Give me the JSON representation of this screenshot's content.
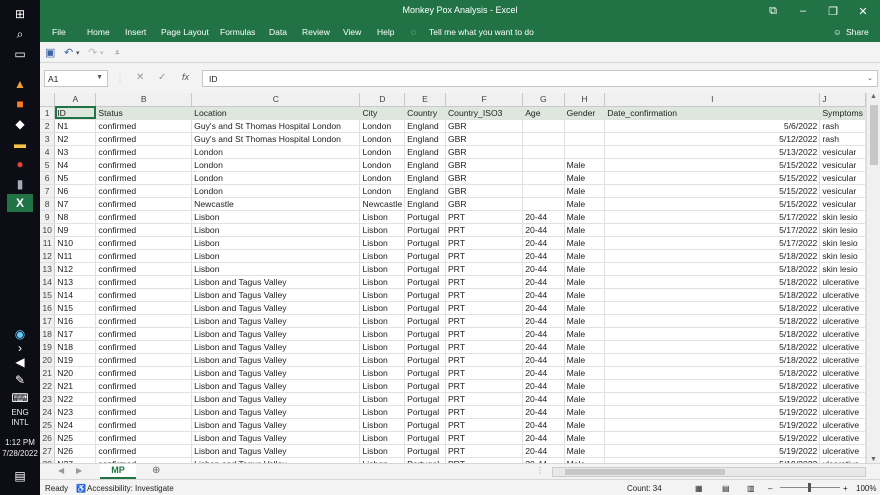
{
  "window": {
    "title": "Monkey Pox Analysis  -  Excel"
  },
  "ribbon": {
    "tabs": [
      "File",
      "Home",
      "Insert",
      "Page Layout",
      "Formulas",
      "Data",
      "Review",
      "View",
      "Help"
    ],
    "tell_me": "Tell me what you want to do",
    "share": "Share"
  },
  "formula_bar": {
    "name_box": "A1",
    "content": "ID",
    "fx": "fx"
  },
  "columns": [
    "A",
    "B",
    "C",
    "D",
    "E",
    "F",
    "G",
    "H",
    "I",
    "J"
  ],
  "headers": [
    "ID",
    "Status",
    "Location",
    "City",
    "Country",
    "Country_ISO3",
    "Age",
    "Gender",
    "Date_confirmation",
    "Symptoms"
  ],
  "rows": [
    [
      "2",
      "N1",
      "confirmed",
      "Guy's and St Thomas Hospital London",
      "London",
      "England",
      "GBR",
      "",
      "",
      "5/6/2022",
      "rash"
    ],
    [
      "3",
      "N2",
      "confirmed",
      "Guy's and St Thomas Hospital London",
      "London",
      "England",
      "GBR",
      "",
      "",
      "5/12/2022",
      "rash"
    ],
    [
      "4",
      "N3",
      "confirmed",
      "London",
      "London",
      "England",
      "GBR",
      "",
      "",
      "5/13/2022",
      "vesicular"
    ],
    [
      "5",
      "N4",
      "confirmed",
      "London",
      "London",
      "England",
      "GBR",
      "",
      "Male",
      "5/15/2022",
      "vesicular"
    ],
    [
      "6",
      "N5",
      "confirmed",
      "London",
      "London",
      "England",
      "GBR",
      "",
      "Male",
      "5/15/2022",
      "vesicular"
    ],
    [
      "7",
      "N6",
      "confirmed",
      "London",
      "London",
      "England",
      "GBR",
      "",
      "Male",
      "5/15/2022",
      "vesicular"
    ],
    [
      "8",
      "N7",
      "confirmed",
      "Newcastle",
      "Newcastle",
      "England",
      "GBR",
      "",
      "Male",
      "5/15/2022",
      "vesicular"
    ],
    [
      "9",
      "N8",
      "confirmed",
      "Lisbon",
      "Lisbon",
      "Portugal",
      "PRT",
      "20-44",
      "Male",
      "5/17/2022",
      "skin lesio"
    ],
    [
      "10",
      "N9",
      "confirmed",
      "Lisbon",
      "Lisbon",
      "Portugal",
      "PRT",
      "20-44",
      "Male",
      "5/17/2022",
      "skin lesio"
    ],
    [
      "11",
      "N10",
      "confirmed",
      "Lisbon",
      "Lisbon",
      "Portugal",
      "PRT",
      "20-44",
      "Male",
      "5/17/2022",
      "skin lesio"
    ],
    [
      "12",
      "N11",
      "confirmed",
      "Lisbon",
      "Lisbon",
      "Portugal",
      "PRT",
      "20-44",
      "Male",
      "5/18/2022",
      "skin lesio"
    ],
    [
      "13",
      "N12",
      "confirmed",
      "Lisbon",
      "Lisbon",
      "Portugal",
      "PRT",
      "20-44",
      "Male",
      "5/18/2022",
      "skin lesio"
    ],
    [
      "14",
      "N13",
      "confirmed",
      "Lisbon and Tagus Valley",
      "Lisbon",
      "Portugal",
      "PRT",
      "20-44",
      "Male",
      "5/18/2022",
      "ulcerative"
    ],
    [
      "15",
      "N14",
      "confirmed",
      "Lisbon and Tagus Valley",
      "Lisbon",
      "Portugal",
      "PRT",
      "20-44",
      "Male",
      "5/18/2022",
      "ulcerative"
    ],
    [
      "16",
      "N15",
      "confirmed",
      "Lisbon and Tagus Valley",
      "Lisbon",
      "Portugal",
      "PRT",
      "20-44",
      "Male",
      "5/18/2022",
      "ulcerative"
    ],
    [
      "17",
      "N16",
      "confirmed",
      "Lisbon and Tagus Valley",
      "Lisbon",
      "Portugal",
      "PRT",
      "20-44",
      "Male",
      "5/18/2022",
      "ulcerative"
    ],
    [
      "18",
      "N17",
      "confirmed",
      "Lisbon and Tagus Valley",
      "Lisbon",
      "Portugal",
      "PRT",
      "20-44",
      "Male",
      "5/18/2022",
      "ulcerative"
    ],
    [
      "19",
      "N18",
      "confirmed",
      "Lisbon and Tagus Valley",
      "Lisbon",
      "Portugal",
      "PRT",
      "20-44",
      "Male",
      "5/18/2022",
      "ulcerative"
    ],
    [
      "20",
      "N19",
      "confirmed",
      "Lisbon and Tagus Valley",
      "Lisbon",
      "Portugal",
      "PRT",
      "20-44",
      "Male",
      "5/18/2022",
      "ulcerative"
    ],
    [
      "21",
      "N20",
      "confirmed",
      "Lisbon and Tagus Valley",
      "Lisbon",
      "Portugal",
      "PRT",
      "20-44",
      "Male",
      "5/18/2022",
      "ulcerative"
    ],
    [
      "22",
      "N21",
      "confirmed",
      "Lisbon and Tagus Valley",
      "Lisbon",
      "Portugal",
      "PRT",
      "20-44",
      "Male",
      "5/18/2022",
      "ulcerative"
    ],
    [
      "23",
      "N22",
      "confirmed",
      "Lisbon and Tagus Valley",
      "Lisbon",
      "Portugal",
      "PRT",
      "20-44",
      "Male",
      "5/19/2022",
      "ulcerative"
    ],
    [
      "24",
      "N23",
      "confirmed",
      "Lisbon and Tagus Valley",
      "Lisbon",
      "Portugal",
      "PRT",
      "20-44",
      "Male",
      "5/19/2022",
      "ulcerative"
    ],
    [
      "25",
      "N24",
      "confirmed",
      "Lisbon and Tagus Valley",
      "Lisbon",
      "Portugal",
      "PRT",
      "20-44",
      "Male",
      "5/19/2022",
      "ulcerative"
    ],
    [
      "26",
      "N25",
      "confirmed",
      "Lisbon and Tagus Valley",
      "Lisbon",
      "Portugal",
      "PRT",
      "20-44",
      "Male",
      "5/19/2022",
      "ulcerative"
    ],
    [
      "27",
      "N26",
      "confirmed",
      "Lisbon and Tagus Valley",
      "Lisbon",
      "Portugal",
      "PRT",
      "20-44",
      "Male",
      "5/19/2022",
      "ulcerative"
    ],
    [
      "28",
      "N27",
      "confirmed",
      "Lisbon and Tagus Valley",
      "Lisbon",
      "Portugal",
      "PRT",
      "20-44",
      "Male",
      "5/19/2022",
      "ulcerative"
    ]
  ],
  "sheet_tab": "MP",
  "status": {
    "ready": "Ready",
    "accessibility": "Accessibility: Investigate",
    "count": "Count: 34",
    "zoom": "100%"
  },
  "taskbar": {
    "lang1": "ENG",
    "lang2": "INTL",
    "time": "1:12 PM",
    "date": "7/28/2022"
  },
  "colors": {
    "accent": "#217346",
    "header_row": "#dde7dd"
  }
}
